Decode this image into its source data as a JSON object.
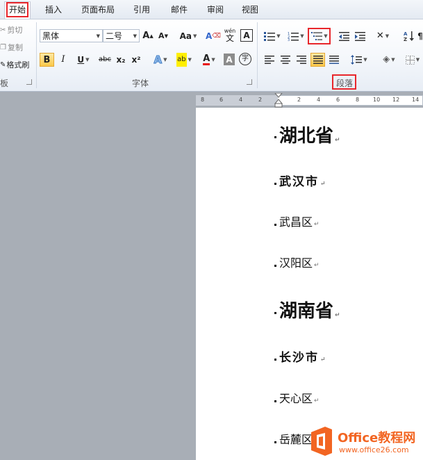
{
  "tabs": [
    "开始",
    "插入",
    "页面布局",
    "引用",
    "邮件",
    "审阅",
    "视图"
  ],
  "clipboard": {
    "cut_label": "剪切",
    "copy_label": "复制",
    "format_painter_label": "格式刷",
    "group_label_partial": "板"
  },
  "font": {
    "font_name": "黑体",
    "font_size": "二号",
    "grow_label": "A",
    "shrink_label": "A",
    "change_case_label": "Aa",
    "clear_format_label": "A",
    "phonetic_label": "wén",
    "char_border_label": "A",
    "bold_label": "B",
    "italic_label": "I",
    "underline_label": "U",
    "strike_label": "abc",
    "subscript_label": "x₂",
    "superscript_label": "x²",
    "text_effect_label": "A",
    "highlight_label": "ab",
    "font_color_label": "A",
    "char_shading_label": "A",
    "enclose_label": "字",
    "group_label": "字体"
  },
  "paragraph": {
    "group_label": "段落"
  },
  "ruler_ticks": [
    "8",
    "6",
    "4",
    "2",
    "",
    "2",
    "4",
    "6",
    "8",
    "10",
    "12",
    "14"
  ],
  "document": {
    "lines": [
      {
        "text": "湖北省",
        "level": 1
      },
      {
        "text": "武汉市",
        "level": 2
      },
      {
        "text": "武昌区",
        "level": 3
      },
      {
        "text": "汉阳区",
        "level": 3
      },
      {
        "text": "湖南省",
        "level": 1
      },
      {
        "text": "长沙市",
        "level": 2
      },
      {
        "text": "天心区",
        "level": 3
      },
      {
        "text": "岳麓区",
        "level": 3
      }
    ],
    "paragraph_mark": "↵"
  },
  "watermark": {
    "brand": "Office教程网",
    "url": "www.office26.com"
  },
  "colors": {
    "highlight_red": "#e8262b",
    "active_button": "#fbc94a",
    "watermark_orange": "#f26522"
  }
}
